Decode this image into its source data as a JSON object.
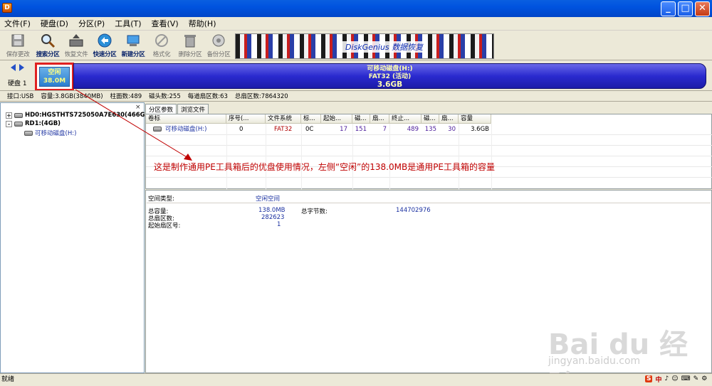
{
  "window": {
    "minimize_glyph": "_",
    "maximize_glyph": "□",
    "close_glyph": "✕"
  },
  "menu": [
    "文件(F)",
    "硬盘(D)",
    "分区(P)",
    "工具(T)",
    "查看(V)",
    "帮助(H)"
  ],
  "toolbar": [
    {
      "label": "保存更改",
      "icon": "save-icon",
      "style": "dim"
    },
    {
      "label": "搜索分区",
      "icon": "search-icon",
      "style": "bold"
    },
    {
      "label": "恢复文件",
      "icon": "restore-icon",
      "style": "dim"
    },
    {
      "label": "快速分区",
      "icon": "quick-partition-icon",
      "style": "bold"
    },
    {
      "label": "新建分区",
      "icon": "new-partition-icon",
      "style": "bold"
    },
    {
      "label": "格式化",
      "icon": "format-icon",
      "style": "dim"
    },
    {
      "label": "删除分区",
      "icon": "delete-icon",
      "style": "dim"
    },
    {
      "label": "备份分区",
      "icon": "backup-icon",
      "style": "dim"
    }
  ],
  "banner": {
    "text": "DiskGenius 数据恢复"
  },
  "disk_nav": {
    "label": "硬盘 1"
  },
  "free_block": {
    "line1": "空闲",
    "line2": "38.0M"
  },
  "partition_bar": {
    "line1": "可移动磁盘(H:)",
    "line2": "FAT32 (活动)",
    "line3": "3.6GB"
  },
  "info_line": [
    "接口:USB",
    "容量:3.8GB(3840MB)",
    "柱面数:489",
    "磁头数:255",
    "每道扇区数:63",
    "总扇区数:7864320"
  ],
  "tree": {
    "close_glyph": "×",
    "items": [
      {
        "label": "HD0:HGSTHTS725050A7E630(466GB)",
        "expander": "+"
      },
      {
        "label": "RD1:(4GB)",
        "expander": "-"
      },
      {
        "label": "可移动磁盘(H:)"
      }
    ]
  },
  "tabs": [
    "分区参数",
    "浏览文件"
  ],
  "grid": {
    "headers": [
      "卷标",
      "序号(...",
      "文件系统",
      "标...",
      "起始...",
      "磁...",
      "扇...",
      "终止...",
      "磁...",
      "扇...",
      "容量"
    ],
    "rows": [
      {
        "label": "可移动磁盘(H:)",
        "index": "0",
        "fs": "FAT32",
        "flag": "0C",
        "start_cyl": "17",
        "start_head": "151",
        "start_sec": "7",
        "end_cyl": "489",
        "end_head": "135",
        "end_sec": "30",
        "capacity": "3.6GB"
      }
    ]
  },
  "annotation": "这是制作通用PE工具箱后的优盘使用情况，左侧“空闲”的138.0MB是通用PE工具箱的容量",
  "details": {
    "space_type_label": "空间类型:",
    "space_type_value": "空闲空间",
    "total_capacity_label": "总容量:",
    "total_capacity_value": "138.0MB",
    "total_bytes_label": "总字节数:",
    "total_bytes_value": "144702976",
    "total_sectors_label": "总扇区数:",
    "total_sectors_value": "282623",
    "start_sector_label": "起始扇区号:",
    "start_sector_value": "1"
  },
  "status": "就绪",
  "tray": [
    "S",
    "中",
    "♪",
    "☺",
    "⌨",
    "✎",
    "⚙"
  ],
  "watermark": {
    "main": "Bai du 经验",
    "sub": "jingyan.baidu.com"
  },
  "colors": {
    "titlebar": "#0053df",
    "partition": "#2a2acf",
    "free": "#2b7fd0",
    "highlight": "#e02020",
    "annotation": "#c00000"
  }
}
